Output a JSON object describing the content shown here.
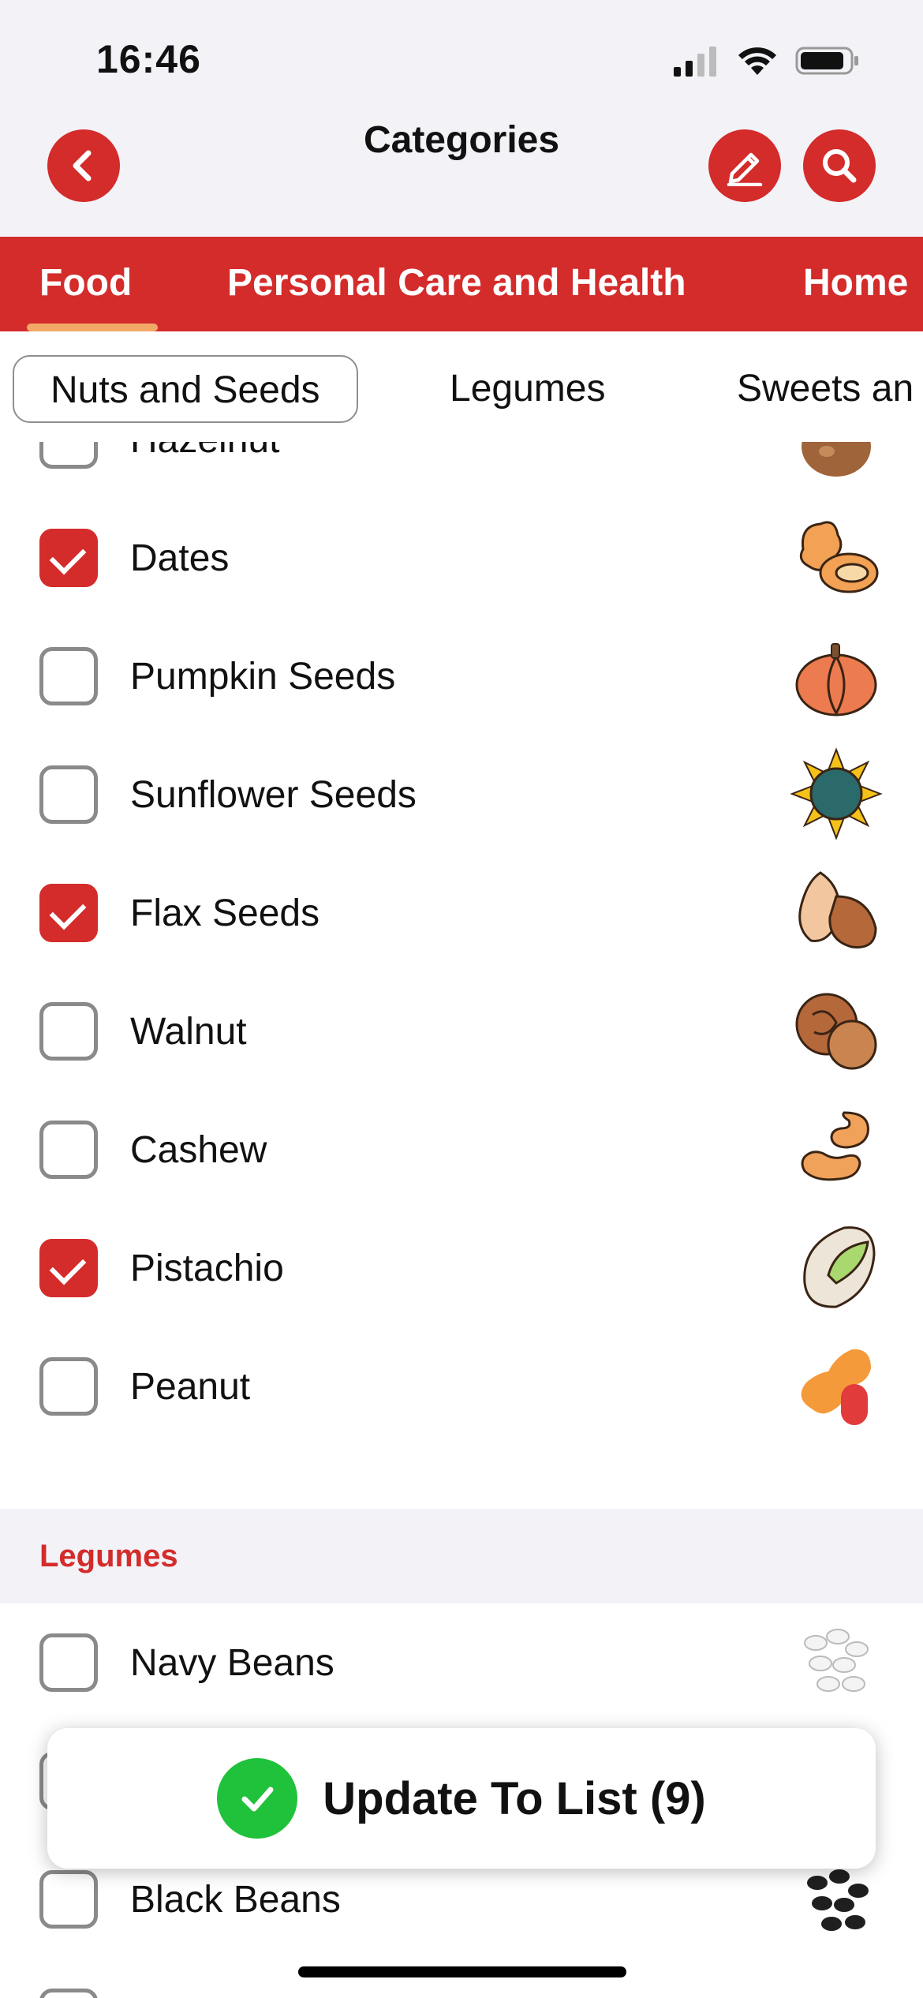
{
  "status_bar": {
    "time": "16:46",
    "icons": [
      "cellular-signal-icon",
      "wifi-icon",
      "battery-icon"
    ]
  },
  "header": {
    "title": "Categories",
    "back_icon": "chevron-left-icon",
    "edit_icon": "pencil-icon",
    "search_icon": "search-icon"
  },
  "category_tabs": [
    {
      "label": "Food",
      "active": true
    },
    {
      "label": "Personal Care and Health",
      "active": false
    },
    {
      "label": "Home",
      "active": false
    }
  ],
  "subcategory_tabs": [
    {
      "label": "Nuts and Seeds",
      "active": true
    },
    {
      "label": "Legumes",
      "active": false
    },
    {
      "label": "Sweets an",
      "active": false
    }
  ],
  "nuts_items": [
    {
      "label": "Hazelnut",
      "checked": false,
      "icon": "hazelnut-icon"
    },
    {
      "label": "Dates",
      "checked": true,
      "icon": "dates-icon"
    },
    {
      "label": "Pumpkin Seeds",
      "checked": false,
      "icon": "pumpkin-icon"
    },
    {
      "label": "Sunflower Seeds",
      "checked": false,
      "icon": "sunflower-icon"
    },
    {
      "label": "Flax Seeds",
      "checked": true,
      "icon": "almond-icon"
    },
    {
      "label": "Walnut",
      "checked": false,
      "icon": "walnut-icon"
    },
    {
      "label": "Cashew",
      "checked": false,
      "icon": "cashew-icon"
    },
    {
      "label": "Pistachio",
      "checked": true,
      "icon": "pistachio-icon"
    },
    {
      "label": "Peanut",
      "checked": false,
      "icon": "peanut-icon"
    }
  ],
  "legumes_section": {
    "title": "Legumes",
    "items": [
      {
        "label": "Navy Beans",
        "checked": false,
        "icon": "navy-beans-icon"
      },
      {
        "label": "",
        "checked": false,
        "icon": "beans-icon"
      },
      {
        "label": "Black Beans",
        "checked": false,
        "icon": "black-beans-icon"
      }
    ]
  },
  "update_button": {
    "label": "Update To List (9)",
    "icon": "checkmark-icon"
  },
  "colors": {
    "accent": "#d42b2b",
    "success": "#1fc23a",
    "tab_underline": "#f2a968",
    "section_bg": "#f2f2f7"
  }
}
